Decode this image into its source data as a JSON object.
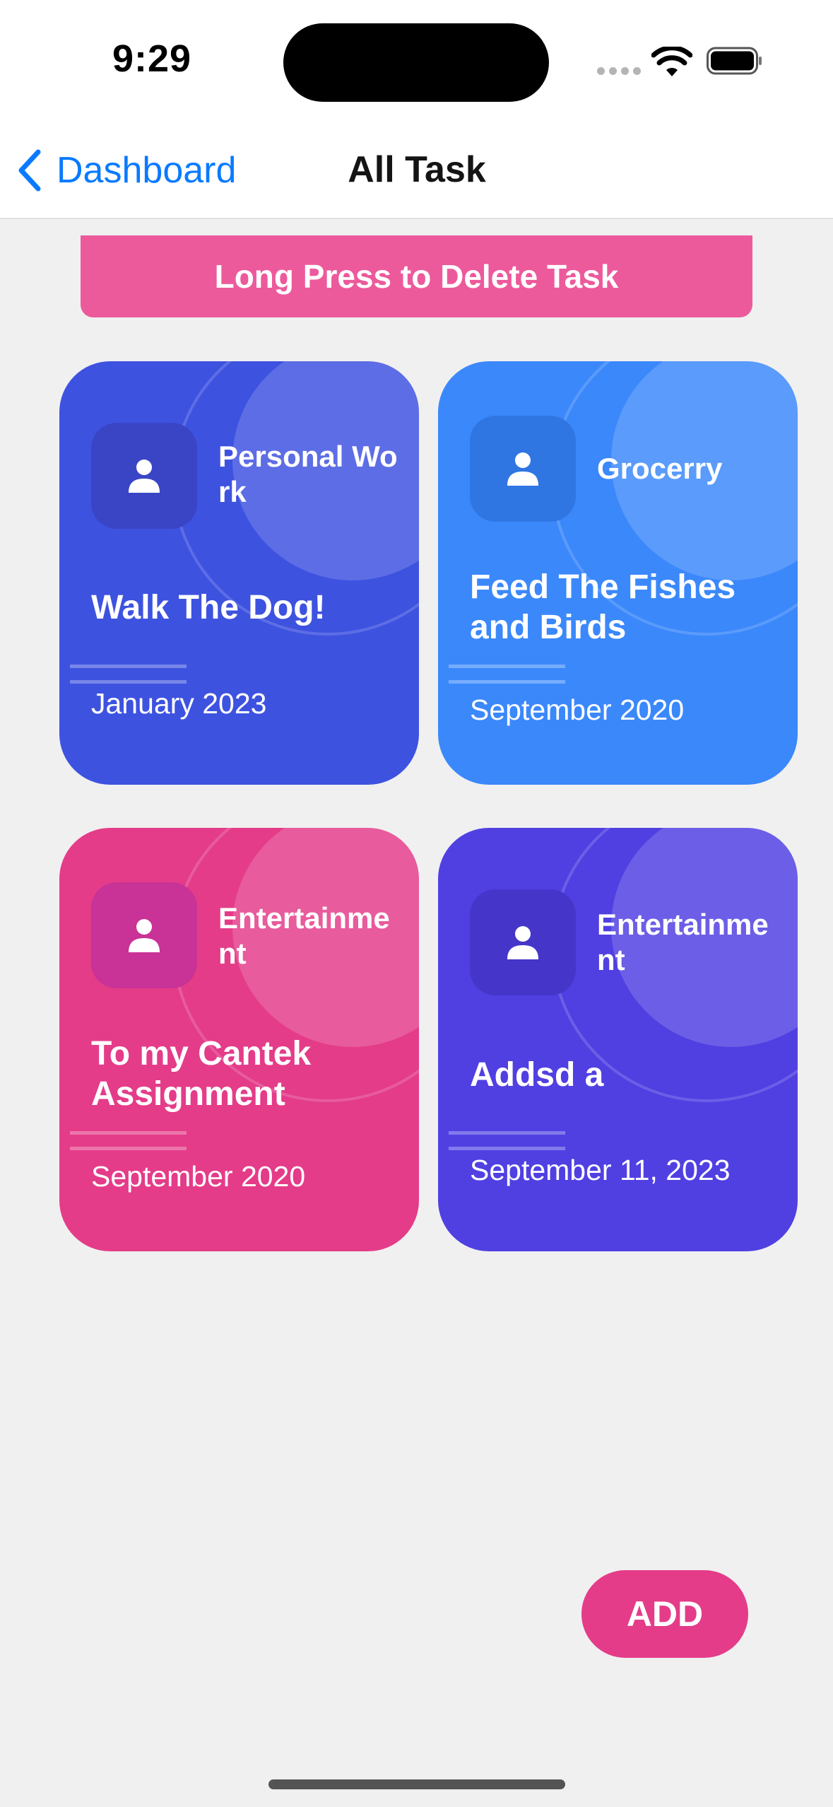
{
  "status_bar": {
    "time": "9:29"
  },
  "nav": {
    "back_label": "Dashboard",
    "title": "All Task"
  },
  "banner": {
    "text": "Long Press to Delete Task"
  },
  "tasks": [
    {
      "category": "Personal Work",
      "title": "Walk The Dog!",
      "date": "January 2023",
      "color": "#3e52e0",
      "icon": "person-icon"
    },
    {
      "category": "Grocerry",
      "title": "Feed The Fishes and Birds",
      "date": "September 2020",
      "color": "#3b88fb",
      "icon": "person-icon"
    },
    {
      "category": "Entertainment",
      "title": "To my Cantek Assignment",
      "date": "September 2020",
      "color": "#e43c89",
      "icon": "person-icon"
    },
    {
      "category": "Entertainment",
      "title": "Addsd a",
      "date": "September 11, 2023",
      "color": "#5040e2",
      "icon": "person-icon"
    }
  ],
  "fab": {
    "label": "ADD"
  },
  "colors": {
    "accent_pink": "#e43c89",
    "banner_pink": "#ec5a9c",
    "ios_blue": "#0a7aff",
    "background": "#f0f0f0"
  }
}
